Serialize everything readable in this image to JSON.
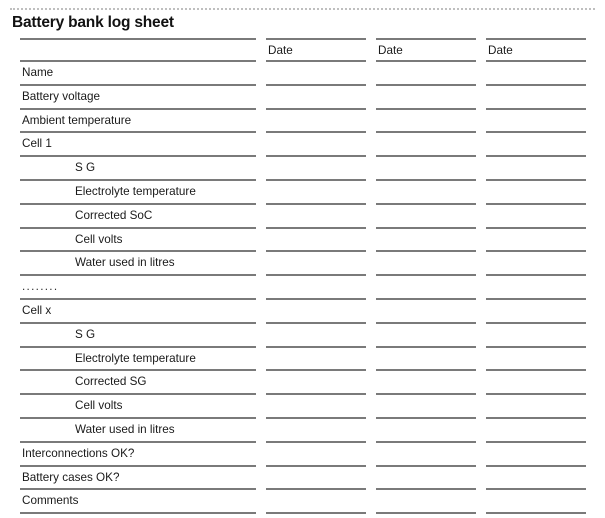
{
  "page": {
    "title": "Battery bank log sheet"
  },
  "table": {
    "label_column_header": "",
    "date_headers": [
      "Date",
      "Date",
      "Date"
    ],
    "rows": [
      {
        "label": "Name",
        "indent": false,
        "dots": false
      },
      {
        "label": "Battery voltage",
        "indent": false,
        "dots": false
      },
      {
        "label": "Ambient temperature",
        "indent": false,
        "dots": false
      },
      {
        "label": "Cell 1",
        "indent": false,
        "dots": false
      },
      {
        "label": "S G",
        "indent": true,
        "dots": false
      },
      {
        "label": "Electrolyte temperature",
        "indent": true,
        "dots": false
      },
      {
        "label": "Corrected SoC",
        "indent": true,
        "dots": false
      },
      {
        "label": "Cell volts",
        "indent": true,
        "dots": false
      },
      {
        "label": "Water used in litres",
        "indent": true,
        "dots": false
      },
      {
        "label": "........",
        "indent": false,
        "dots": true
      },
      {
        "label": "Cell x",
        "indent": false,
        "dots": false
      },
      {
        "label": "S G",
        "indent": true,
        "dots": false
      },
      {
        "label": "Electrolyte temperature",
        "indent": true,
        "dots": false
      },
      {
        "label": "Corrected SG",
        "indent": true,
        "dots": false
      },
      {
        "label": "Cell volts",
        "indent": true,
        "dots": false
      },
      {
        "label": "Water used in litres",
        "indent": true,
        "dots": false
      },
      {
        "label": "Interconnections OK?",
        "indent": false,
        "dots": false
      },
      {
        "label": "Battery cases OK?",
        "indent": false,
        "dots": false
      },
      {
        "label": "Comments",
        "indent": false,
        "dots": false
      }
    ]
  },
  "style": {
    "rule_color": "#7a7a7a",
    "dotted_color": "#bfbfbf",
    "text_color": "#1a1a1a"
  }
}
